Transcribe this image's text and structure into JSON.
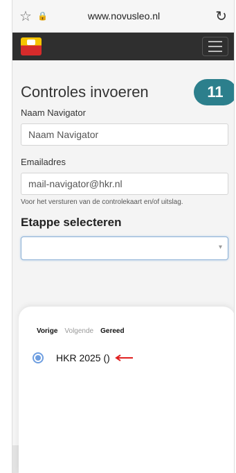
{
  "browser": {
    "url": "www.novusleo.nl"
  },
  "page": {
    "title": "Controles invoeren",
    "badge_count": "11",
    "navigator_label": "Naam Navigator",
    "navigator_value": "Naam Navigator",
    "email_label": "Emailadres",
    "email_value": "mail-navigator@hkr.nl",
    "email_hint": "Voor het versturen van de controlekaart en/of uitslag.",
    "stage_heading": "Etappe selecteren"
  },
  "picker": {
    "prev_label": "Vorige",
    "next_label": "Volgende",
    "done_label": "Gereed",
    "options": [
      {
        "label": "HKR 2025 ()",
        "selected": true
      }
    ]
  },
  "colors": {
    "badge": "#2c7f8c",
    "navbar": "#2f2f2f",
    "radio": "#6e9ee0",
    "annotation_arrow": "#e02020"
  }
}
